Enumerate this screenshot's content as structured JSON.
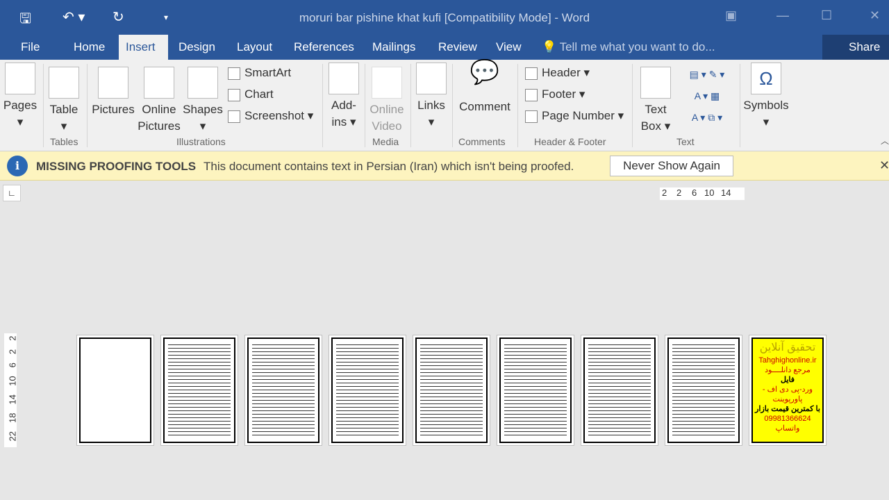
{
  "titlebar": {
    "title": "moruri bar pishine khat kufi [Compatibility Mode] - Word"
  },
  "tabs": [
    {
      "label": "File"
    },
    {
      "label": "Home"
    },
    {
      "label": "Insert",
      "active": true
    },
    {
      "label": "Design"
    },
    {
      "label": "Layout"
    },
    {
      "label": "References"
    },
    {
      "label": "Mailings"
    },
    {
      "label": "Review"
    },
    {
      "label": "View"
    }
  ],
  "tellme": "Tell me what you want to do...",
  "share": "Share",
  "ribbon": {
    "pages": "Pages",
    "table": "Table",
    "pictures": "Pictures",
    "online_pictures_1": "Online",
    "online_pictures_2": "Pictures",
    "shapes": "Shapes",
    "smartart": "SmartArt",
    "chart": "Chart",
    "screenshot": "Screenshot",
    "addins_1": "Add-",
    "addins_2": "ins",
    "online_video_1": "Online",
    "online_video_2": "Video",
    "links": "Links",
    "comment": "Comment",
    "header": "Header",
    "footer": "Footer",
    "page_number": "Page Number",
    "text_box_1": "Text",
    "text_box_2": "Box",
    "symbols": "Symbols",
    "groups": {
      "tables": "Tables",
      "illustrations": "Illustrations",
      "media": "Media",
      "comments": "Comments",
      "header_footer": "Header & Footer",
      "text": "Text"
    }
  },
  "infobar": {
    "heading": "MISSING PROOFING TOOLS",
    "message": "This document contains text in Persian (Iran) which isn't being proofed.",
    "button": "Never Show Again"
  },
  "ruler": {
    "horizontal": [
      "2",
      "2",
      "6",
      "10",
      "14"
    ],
    "vertical": [
      "2",
      "2",
      "6",
      "10",
      "14",
      "18",
      "22"
    ]
  },
  "pages": [
    {
      "type": "blank"
    },
    {
      "type": "text"
    },
    {
      "type": "text"
    },
    {
      "type": "text"
    },
    {
      "type": "text"
    },
    {
      "type": "text"
    },
    {
      "type": "text"
    },
    {
      "type": "text"
    },
    {
      "type": "ad"
    }
  ],
  "ad": {
    "lines": [
      "تحقیق آنلاین",
      "Tahghighonline.ir",
      "مرجع دانلــــود",
      "فایل",
      "ورد-پی دی اف - پاورپوینت",
      "با کمترین قیمت بازار",
      "09981366624 واتساپ"
    ]
  },
  "colors": {
    "accent": "#2b579a",
    "infobar": "#fdf4bf"
  }
}
